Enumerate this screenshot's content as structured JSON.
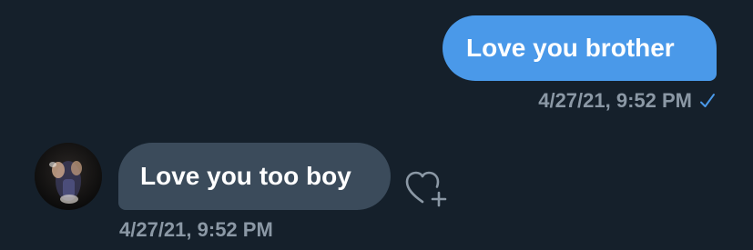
{
  "conversation": {
    "messages": [
      {
        "direction": "sent",
        "text": "Love you brother",
        "timestamp": "4/27/21, 9:52 PM",
        "status_icon": "checkmark-icon"
      },
      {
        "direction": "received",
        "text": "Love you too boy",
        "timestamp": "4/27/21, 9:52 PM",
        "avatar_icon": "avatar",
        "action_icon": "add-reaction-heart-icon"
      }
    ]
  },
  "colors": {
    "background": "#15202b",
    "sent_bubble": "#4a99e9",
    "received_bubble": "#3b4b5b",
    "timestamp": "#8b98a5",
    "read_check": "#4a99e9",
    "reaction_icon": "#8b98a5"
  }
}
